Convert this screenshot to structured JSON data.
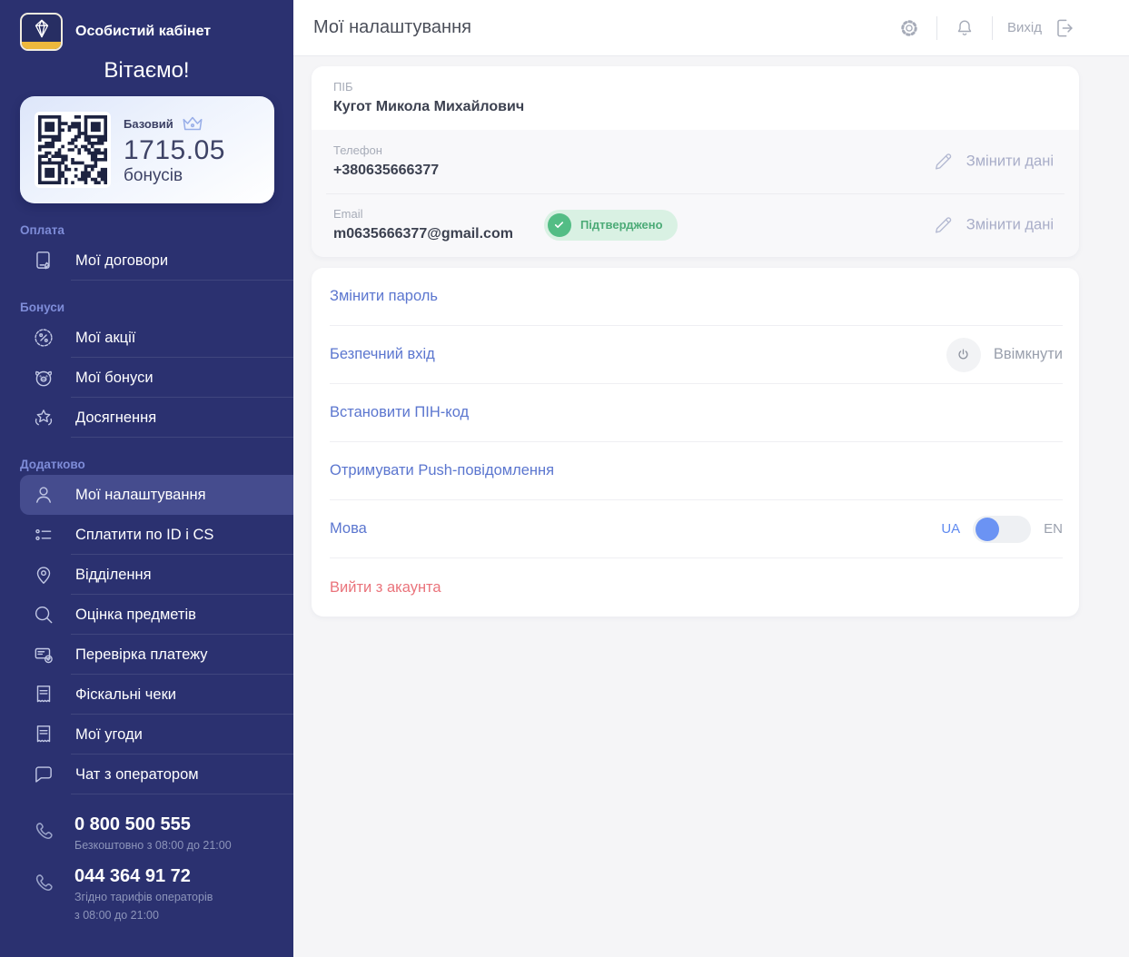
{
  "brand": {
    "app_title": "Особистий кабінет",
    "greeting": "Вітаємо!"
  },
  "bonus_card": {
    "level": "Базовий",
    "amount": "1715.05",
    "unit": "бонусів"
  },
  "sidebar": {
    "sections": [
      {
        "label": "Оплата",
        "items": [
          {
            "label": "Мої договори",
            "icon": "contract-tablet-icon"
          }
        ]
      },
      {
        "label": "Бонуси",
        "items": [
          {
            "label": "Мої акції",
            "icon": "discount-icon"
          },
          {
            "label": "Мої бонуси",
            "icon": "piggy-bank-icon"
          },
          {
            "label": "Досягнення",
            "icon": "achievement-star-icon"
          }
        ]
      },
      {
        "label": "Додатково",
        "items": [
          {
            "label": "Мої налаштування",
            "icon": "user-icon",
            "active": true
          },
          {
            "label": "Сплатити по ID і CS",
            "icon": "list-icon"
          },
          {
            "label": "Відділення",
            "icon": "map-pin-icon"
          },
          {
            "label": "Оцінка предметів",
            "icon": "magnifier-icon"
          },
          {
            "label": "Перевірка платежу",
            "icon": "payment-check-icon"
          },
          {
            "label": "Фіскальні чеки",
            "icon": "receipt-icon"
          },
          {
            "label": "Мої угоди",
            "icon": "receipt-icon"
          },
          {
            "label": "Чат з оператором",
            "icon": "chat-icon"
          }
        ]
      }
    ],
    "phones": [
      {
        "number": "0 800 500 555",
        "notes": [
          "Безкоштовно з 08:00 до 21:00"
        ]
      },
      {
        "number": "044 364 91 72",
        "notes": [
          "Згідно тарифів операторів",
          "з 08:00 до 21:00"
        ]
      }
    ]
  },
  "header": {
    "title": "Мої налаштування",
    "logout_label": "Вихід"
  },
  "profile": {
    "fields": [
      {
        "label": "ПІБ",
        "value": "Кугот Микола Михайлович"
      },
      {
        "label": "Телефон",
        "value": "+380635666377",
        "action": "Змінити дані"
      },
      {
        "label": "Email",
        "value": "m0635666377@gmail.com",
        "badge": "Підтверджено",
        "action": "Змінити дані"
      }
    ]
  },
  "settings": {
    "items": [
      {
        "label": "Змінити пароль"
      },
      {
        "label": "Безпечний вхід",
        "action": "Ввімкнути"
      },
      {
        "label": "Встановити ПІН-код"
      },
      {
        "label": "Отримувати Push-повідомлення"
      },
      {
        "label": "Мова",
        "toggle": {
          "left": "UA",
          "right": "EN",
          "selected": "UA"
        }
      },
      {
        "label": "Вийти з акаунта",
        "danger": true
      }
    ]
  },
  "colors": {
    "sidebar_bg": "#2b3170",
    "sidebar_active": "#454c8e",
    "accent_blue": "#5b76cf",
    "toggle_blue": "#6b93f3",
    "danger_red": "#ea737b",
    "success_green": "#53bd85",
    "success_bg": "#d9f1e3",
    "gold": "#edb83c"
  }
}
